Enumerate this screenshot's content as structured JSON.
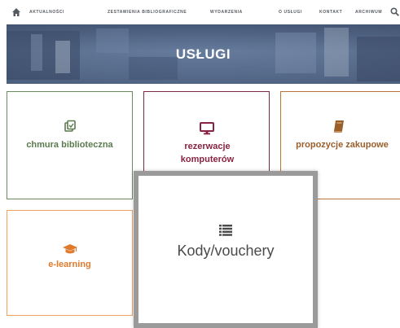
{
  "nav": {
    "items": [
      "AKTUALNOŚCI",
      "ZESTAWIENIA BIBLIOGRAFICZNE",
      "WYDARZENIA",
      "O USŁUGI",
      "KONTAKT",
      "ARCHIWUM"
    ]
  },
  "banner": {
    "title": "USŁUGI"
  },
  "tiles": [
    {
      "label": "chmura biblioteczna",
      "icon": "cloud-doc-icon",
      "color": "#5b7a4e"
    },
    {
      "label": "rezerwacje komputerów",
      "icon": "monitor-icon",
      "color": "#8a2342"
    },
    {
      "label": "propozycje zakupowe",
      "icon": "book-icon",
      "color": "#9a5e2a"
    },
    {
      "label": "e-learning",
      "icon": "graduation-cap-icon",
      "color": "#e07a2c"
    }
  ],
  "modal": {
    "label": "Kody/vouchery",
    "icon": "list-icon"
  },
  "colors": {
    "banner": "#5b6f8f",
    "modal_border": "#9a9a9a"
  }
}
